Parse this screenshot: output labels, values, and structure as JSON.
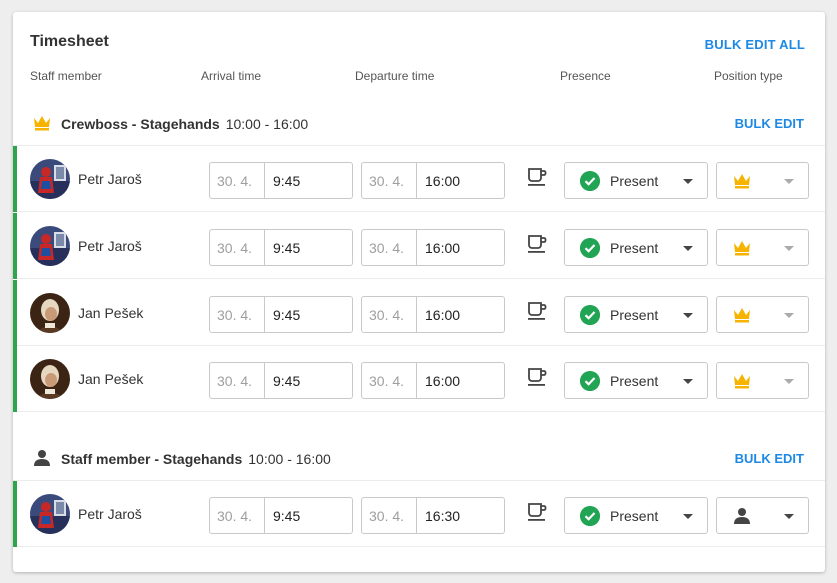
{
  "title": "Timesheet",
  "bulk_edit_all": "BULK EDIT ALL",
  "columns": {
    "staff": "Staff member",
    "arrival": "Arrival time",
    "departure": "Departure time",
    "presence": "Presence",
    "position": "Position type"
  },
  "groups": [
    {
      "name": "Crewboss - Stagehands",
      "time": "10:00 - 16:00",
      "icon": "crown-icon",
      "bulk_edit": "BULK EDIT",
      "rows": [
        {
          "name": "Petr Jaroš",
          "arrival_date": "30. 4.",
          "arrival_time": "9:45",
          "departure_date": "30. 4.",
          "departure_time": "16:00",
          "presence": "Present",
          "position_icon": "crown-icon"
        },
        {
          "name": "Petr Jaroš",
          "arrival_date": "30. 4.",
          "arrival_time": "9:45",
          "departure_date": "30. 4.",
          "departure_time": "16:00",
          "presence": "Present",
          "position_icon": "crown-icon"
        },
        {
          "name": "Jan Pešek",
          "arrival_date": "30. 4.",
          "arrival_time": "9:45",
          "departure_date": "30. 4.",
          "departure_time": "16:00",
          "presence": "Present",
          "position_icon": "crown-icon"
        },
        {
          "name": "Jan Pešek",
          "arrival_date": "30. 4.",
          "arrival_time": "9:45",
          "departure_date": "30. 4.",
          "departure_time": "16:00",
          "presence": "Present",
          "position_icon": "crown-icon"
        }
      ]
    },
    {
      "name": "Staff member - Stagehands",
      "time": "10:00 - 16:00",
      "icon": "person-icon",
      "bulk_edit": "BULK EDIT",
      "rows": [
        {
          "name": "Petr Jaroš",
          "arrival_date": "30. 4.",
          "arrival_time": "9:45",
          "departure_date": "30. 4.",
          "departure_time": "16:30",
          "presence": "Present",
          "position_icon": "person-icon"
        }
      ]
    }
  ],
  "colors": {
    "accent": "#1e88e5",
    "present_green": "#21a453",
    "row_bar": "#2ea44f",
    "crown": "#f6b400"
  }
}
